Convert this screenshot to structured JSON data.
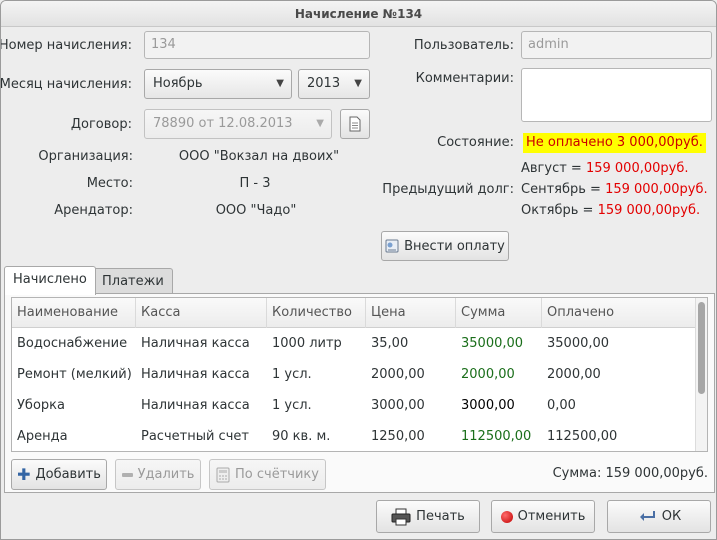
{
  "window": {
    "title": "Начисление №134"
  },
  "form": {
    "number_label": "Номер начисления:",
    "number_value": "134",
    "month_label": "Месяц начисления:",
    "month_value": "Ноябрь",
    "year_value": "2013",
    "contract_label": "Договор:",
    "contract_value": "78890 от 12.08.2013",
    "organization_label": "Организация:",
    "organization_value": "ООО \"Вокзал на двоих\"",
    "place_label": "Место:",
    "place_value": "П - 3",
    "tenant_label": "Арендатор:",
    "tenant_value": "ООО \"Чадо\""
  },
  "right": {
    "user_label": "Пользователь:",
    "user_value": "admin",
    "comments_label": "Комментарии:",
    "comments_value": "",
    "state_label": "Состояние:",
    "state_value": "Не оплачено 3 000,00руб.",
    "debt_label": "Предыдущий долг:",
    "debts": [
      {
        "month": "Август = ",
        "amount": "159 000,00руб."
      },
      {
        "month": "Сентябрь = ",
        "amount": "159 000,00руб."
      },
      {
        "month": "Октябрь = ",
        "amount": "159 000,00руб."
      }
    ],
    "pay_button": "Внести оплату"
  },
  "tabs": [
    {
      "label": "Начислено",
      "active": true
    },
    {
      "label": "Платежи",
      "active": false
    }
  ],
  "table": {
    "columns": [
      "Наименование",
      "Касса",
      "Количество",
      "Цена",
      "Сумма",
      "Оплачено"
    ],
    "rows": [
      {
        "name": "Водоснабжение",
        "cash": "Наличная касса",
        "qty": "1000 литр",
        "price": "35,00",
        "sum": "35000,00",
        "paid": "35000,00",
        "sum_color": "green"
      },
      {
        "name": "Ремонт (мелкий)",
        "cash": "Наличная касса",
        "qty": "1 усл.",
        "price": "2000,00",
        "sum": "2000,00",
        "paid": "2000,00",
        "sum_color": "green"
      },
      {
        "name": "Уборка",
        "cash": "Наличная касса",
        "qty": "1 усл.",
        "price": "3000,00",
        "sum": "3000,00",
        "paid": "0,00",
        "sum_color": "black"
      },
      {
        "name": "Аренда",
        "cash": "Расчетный счет",
        "qty": "90 кв. м.",
        "price": "1250,00",
        "sum": "112500,00",
        "paid": "112500,00",
        "sum_color": "green"
      }
    ]
  },
  "table_buttons": {
    "add": "Добавить",
    "delete": "Удалить",
    "by_meter": "По счётчику"
  },
  "total_text": "Сумма: 159 000,00руб.",
  "footer": {
    "print": "Печать",
    "cancel": "Отменить",
    "ok": "ОК"
  },
  "colors": {
    "red_text": "#e30000",
    "status_bg": "#ffff00",
    "green_text": "#1a6e1a"
  }
}
